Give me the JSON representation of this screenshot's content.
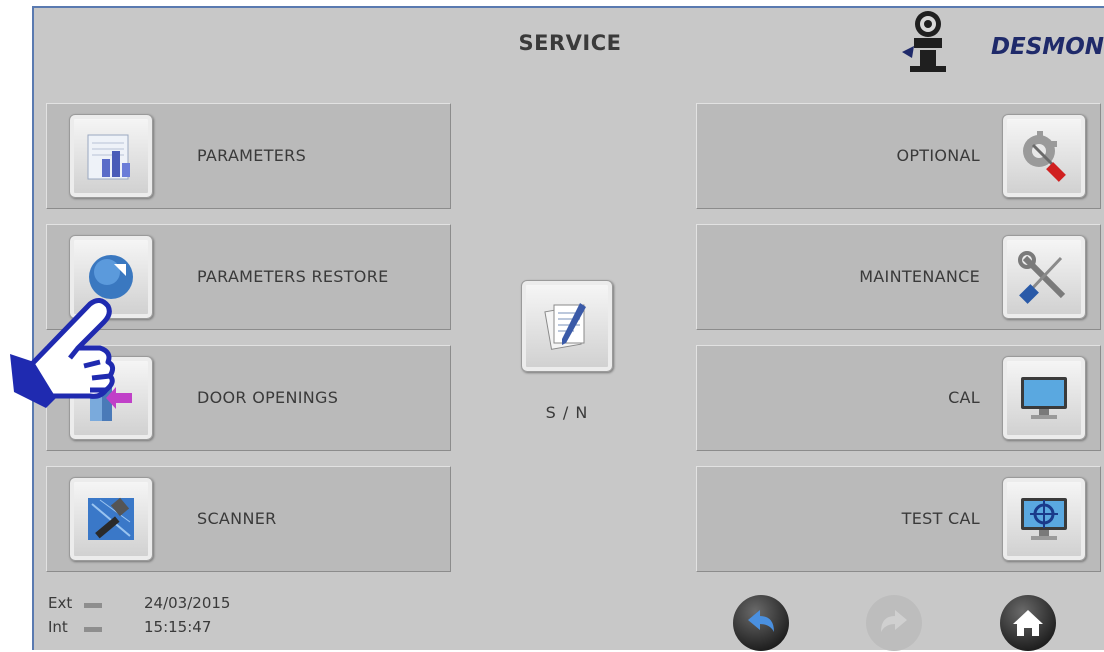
{
  "header": {
    "title": "SERVICE",
    "brand": "DESMON"
  },
  "left_buttons": [
    {
      "label": "PARAMETERS",
      "icon": "parameters-chart-icon"
    },
    {
      "label": "PARAMETERS RESTORE",
      "icon": "restore-icon"
    },
    {
      "label": "DOOR OPENINGS",
      "icon": "door-icon"
    },
    {
      "label": "SCANNER",
      "icon": "scanner-tools-icon"
    }
  ],
  "right_buttons": [
    {
      "label": "OPTIONAL",
      "icon": "gear-screwdriver-icon"
    },
    {
      "label": "MAINTENANCE",
      "icon": "wrench-screwdriver-icon"
    },
    {
      "label": "CAL",
      "icon": "monitor-icon"
    },
    {
      "label": "TEST CAL",
      "icon": "monitor-target-icon"
    }
  ],
  "center": {
    "label": "S / N",
    "icon": "document-pen-icon"
  },
  "status": {
    "ext_label": "Ext",
    "int_label": "Int",
    "date": "24/03/2015",
    "time": "15:15:47"
  },
  "nav": {
    "back": "back-arrow-icon",
    "forward": "forward-arrow-icon",
    "home": "home-icon"
  },
  "colors": {
    "panel_bg": "#c8c8c8",
    "button_bg": "#bababa",
    "brand": "#1f2a6a",
    "nav_dark": "#2c2c2c"
  }
}
